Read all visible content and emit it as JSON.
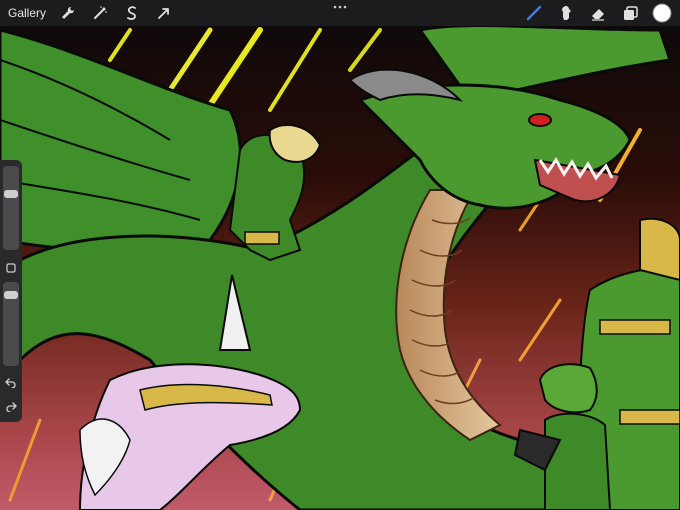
{
  "app": {
    "gallery_label": "Gallery"
  },
  "toolbar": {
    "left_icons": [
      "wrench-icon",
      "magic-wand-icon",
      "selection-icon",
      "transform-arrow-icon"
    ],
    "right_icons": [
      "brush-icon",
      "smudge-icon",
      "eraser-icon",
      "layers-icon",
      "color-swatch-icon"
    ],
    "active_tool": "brush",
    "accent": "#3b7cf5",
    "current_color": "#ffffff"
  },
  "sidebar": {
    "brush_size_level": 0.3,
    "opacity_level": 0.1,
    "icons": [
      "modify-square-icon",
      "undo-icon",
      "redo-icon"
    ]
  }
}
